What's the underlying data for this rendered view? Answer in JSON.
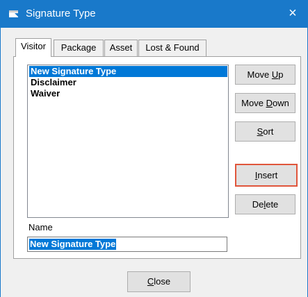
{
  "window": {
    "title": "Signature Type",
    "close_glyph": "×"
  },
  "tabs": [
    {
      "label": "Visitor",
      "active": true
    },
    {
      "label": "Package",
      "active": false
    },
    {
      "label": "Asset",
      "active": false
    },
    {
      "label": "Lost & Found",
      "active": false
    }
  ],
  "list": {
    "items": [
      {
        "label": "New Signature Type",
        "selected": true
      },
      {
        "label": "Disclaimer",
        "selected": false
      },
      {
        "label": "Waiver",
        "selected": false
      }
    ]
  },
  "buttons": {
    "move_up": {
      "pre": "Move ",
      "mn": "U",
      "post": "p"
    },
    "move_down": {
      "pre": "Move ",
      "mn": "D",
      "post": "own"
    },
    "sort": {
      "pre": "",
      "mn": "S",
      "post": "ort"
    },
    "insert": {
      "pre": "",
      "mn": "I",
      "post": "nsert",
      "focused": true
    },
    "delete": {
      "pre": "De",
      "mn": "l",
      "post": "ete"
    },
    "close": {
      "pre": "",
      "mn": "C",
      "post": "lose"
    }
  },
  "name_field": {
    "label": "Name",
    "value": "New Signature Type"
  },
  "colors": {
    "titlebar": "#1979ca",
    "selection": "#0078d7",
    "focus_border": "#e0553b"
  }
}
